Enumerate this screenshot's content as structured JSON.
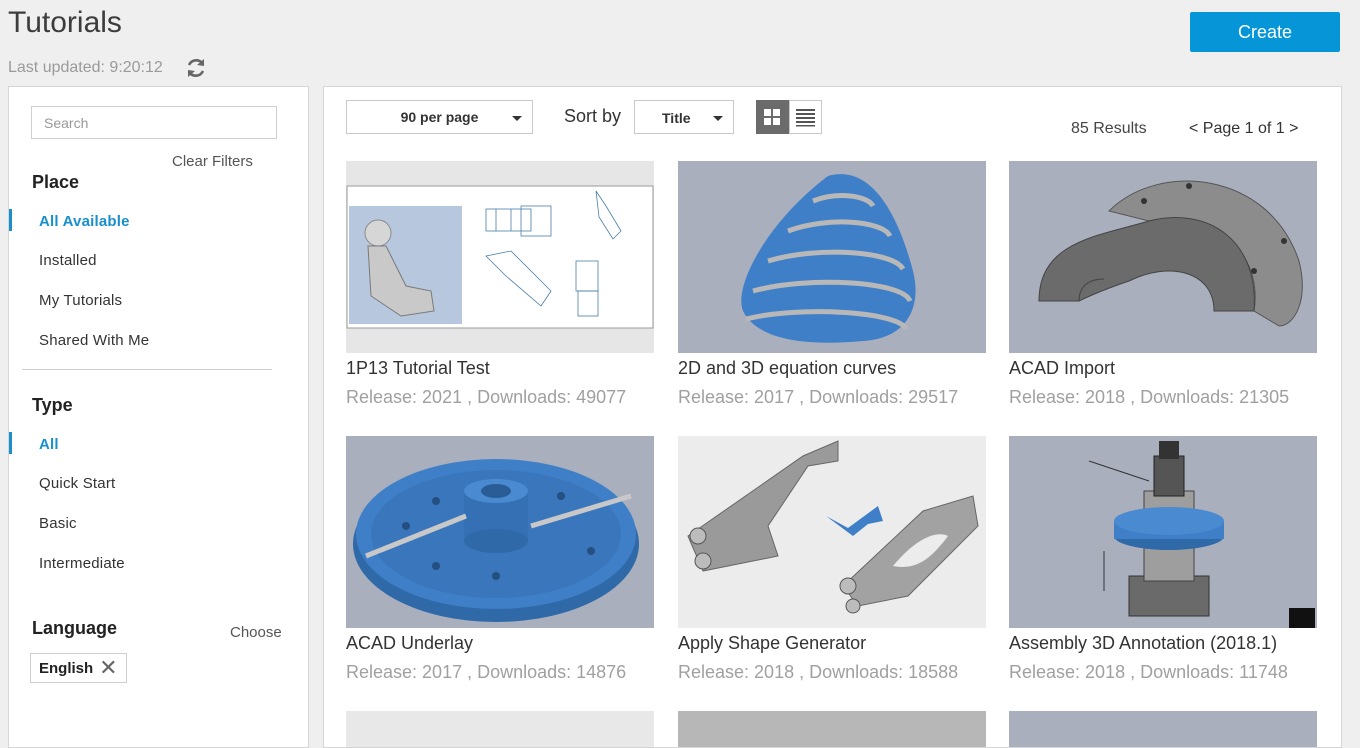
{
  "header": {
    "title": "Tutorials",
    "last_updated": "Last updated: 9:20:12",
    "create_label": "Create"
  },
  "sidebar": {
    "search_placeholder": "Search",
    "clear_filters": "Clear Filters",
    "place": {
      "title": "Place",
      "items": [
        "All Available",
        "Installed",
        "My Tutorials",
        "Shared With Me"
      ]
    },
    "type": {
      "title": "Type",
      "items": [
        "All",
        "Quick Start",
        "Basic",
        "Intermediate"
      ]
    },
    "language": {
      "title": "Language",
      "choose_label": "Choose",
      "chip": "English"
    }
  },
  "toolbar": {
    "per_page": "90 per page",
    "sort_by_label": "Sort by",
    "sort_value": "Title",
    "results": "85 Results",
    "pager_prev": "<",
    "pager_text": "Page 1 of 1",
    "pager_next": ">"
  },
  "cards": [
    {
      "title": "1P13 Tutorial Test",
      "meta": "Release: 2021 , Downloads: 49077"
    },
    {
      "title": "2D and 3D equation curves",
      "meta": "Release: 2017 , Downloads: 29517"
    },
    {
      "title": "ACAD Import",
      "meta": "Release: 2018 , Downloads: 21305"
    },
    {
      "title": "ACAD Underlay",
      "meta": "Release: 2017 , Downloads: 14876"
    },
    {
      "title": "Apply Shape Generator",
      "meta": "Release: 2018 , Downloads: 18588"
    },
    {
      "title": "Assembly 3D Annotation (2018.1)",
      "meta": "Release: 2018 , Downloads: 11748"
    }
  ],
  "colors": {
    "accent": "#0696d7",
    "active_filter": "#1a8fcc",
    "model_blue": "#3f7fc8",
    "thumb_bg": "#a8afbd"
  }
}
